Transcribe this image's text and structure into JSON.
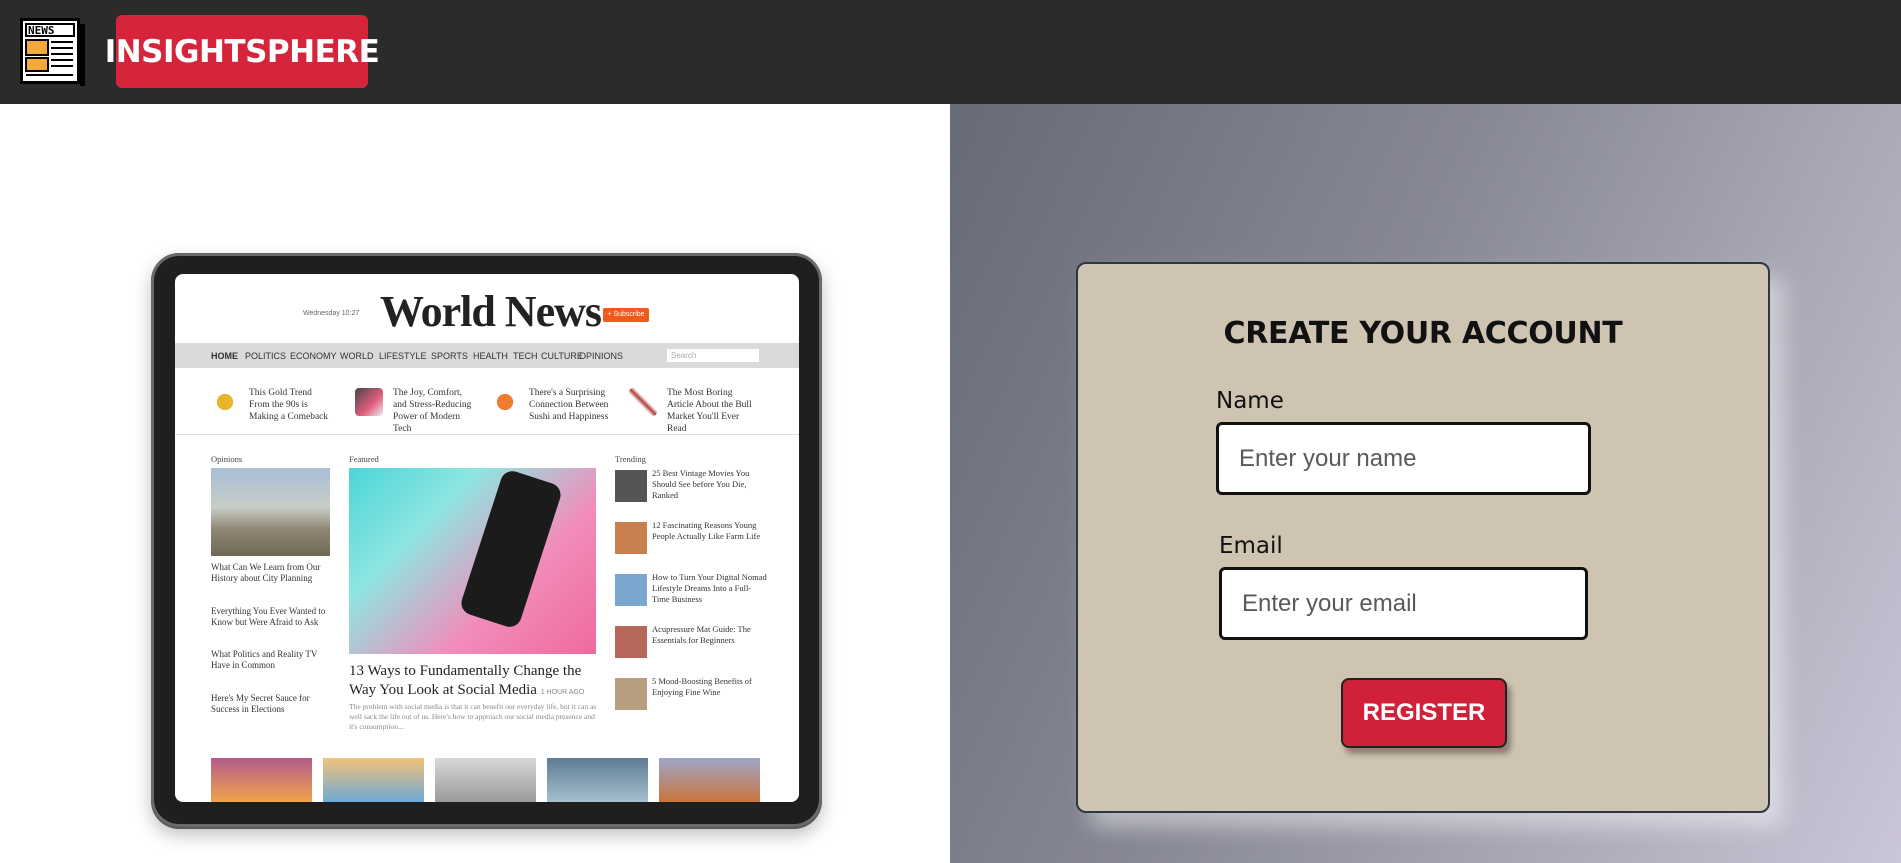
{
  "header": {
    "logo_text": "NEWS",
    "brand": "INSIGHTSPHERE"
  },
  "hero": {
    "masthead_date": "Wednesday 10:27",
    "masthead_title": "World News",
    "subscribe": "+ Subscribe",
    "nav": [
      "HOME",
      "POLITICS",
      "ECONOMY",
      "WORLD",
      "LIFESTYLE",
      "SPORTS",
      "HEALTH",
      "TECH",
      "CULTURE",
      "OPINIONS"
    ],
    "search_placeholder": "Search",
    "headlines": [
      "This Gold Trend From the 90s is Making a Comeback",
      "The Joy, Comfort, and Stress-Reducing Power of Modern Tech",
      "There's a Surprising Connection Between Sushi and Happiness",
      "The Most Boring Article About the Bull Market You'll Ever Read"
    ],
    "opinions_label": "Opinions",
    "featured_label": "Featured",
    "trending_label": "Trending",
    "opinions": [
      "What Can We Learn from Our History about City Planning",
      "Everything You Ever Wanted to Know but Were Afraid to Ask",
      "What Politics and Reality TV Have in Common",
      "Here's My Secret Sauce for Success in Elections"
    ],
    "featured_title": "13 Ways to Fundamentally Change the Way You Look at Social Media",
    "featured_time": "1 HOUR AGO",
    "featured_body": "The problem with social media is that it can benefit our everyday life, but it can as well sack the life out of us. Here's how to approach our social media presence and it's consumption...",
    "trending": [
      "25 Best Vintage Movies You Should See before You Die, Ranked",
      "12 Fascinating Reasons Young People Actually Like Farm Life",
      "How to Turn Your Digital Nomad Lifestyle Dreams Into a Full-Time Business",
      "Acupressure Mat Guide: The Essentials for Beginners",
      "5 Mood-Boosting Benefits of Enjoying Fine Wine"
    ]
  },
  "form": {
    "title": "CREATE YOUR ACCOUNT",
    "name_label": "Name",
    "name_placeholder": "Enter your name",
    "email_label": "Email",
    "email_placeholder": "Enter your email",
    "register": "REGISTER"
  },
  "colors": {
    "header_bg": "#2b2b2b",
    "brand_red": "#d6243b",
    "card_bg": "#cfc4b2",
    "button_red": "#d0203a"
  },
  "icons": [
    "newspaper-icon"
  ]
}
